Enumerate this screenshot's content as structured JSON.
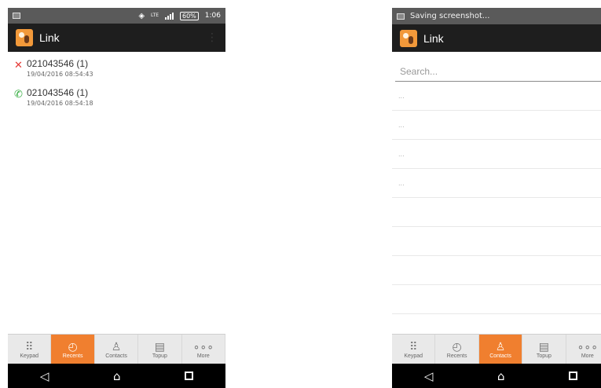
{
  "left": {
    "status": {
      "battery": "60%",
      "time": "1:06",
      "network": "LTE"
    },
    "app_title": "Link",
    "recents": [
      {
        "number": "021043546 (1)",
        "time": "19/04/2016 08:54:43",
        "type": "missed",
        "icon": "missed-call-icon"
      },
      {
        "number": "021043546 (1)",
        "time": "19/04/2016 08:54:18",
        "type": "incoming",
        "icon": "incoming-call-icon"
      }
    ],
    "nav": [
      {
        "label": "Keypad",
        "icon": "keypad-icon"
      },
      {
        "label": "Recents",
        "icon": "clock-icon"
      },
      {
        "label": "Contacts",
        "icon": "person-icon"
      },
      {
        "label": "Topup",
        "icon": "coins-icon"
      },
      {
        "label": "More",
        "icon": "dots-icon"
      }
    ],
    "active_nav": "Recents"
  },
  "right": {
    "status": {
      "notification": "Saving screenshot..."
    },
    "app_title": "Link",
    "search_placeholder": "Search...",
    "contacts": [
      "...",
      "...",
      "...",
      "..."
    ],
    "nav": [
      {
        "label": "Keypad",
        "icon": "keypad-icon"
      },
      {
        "label": "Recents",
        "icon": "clock-icon"
      },
      {
        "label": "Contacts",
        "icon": "person-icon"
      },
      {
        "label": "Topup",
        "icon": "coins-icon"
      },
      {
        "label": "More",
        "icon": "dots-icon"
      }
    ],
    "active_nav": "Contacts"
  },
  "colors": {
    "accent": "#f07f2f",
    "appbar": "#1e1e1e",
    "missed": "#e53935",
    "incoming": "#2eaa3a"
  }
}
